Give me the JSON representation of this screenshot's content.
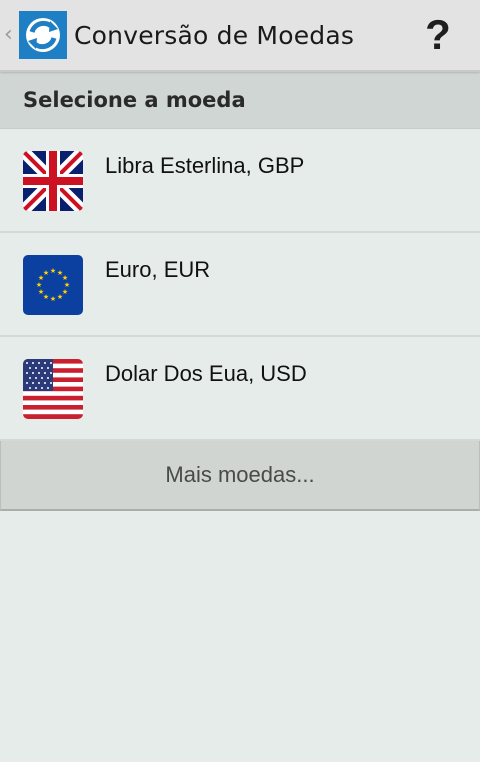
{
  "app": {
    "title": "Conversão de Moedas",
    "back_icon": "back-caret-icon",
    "app_icon": "refresh-exchange-icon",
    "help_label": "?"
  },
  "section": {
    "header": "Selecione a moeda"
  },
  "currencies": [
    {
      "label": "Libra Esterlina, GBP",
      "flag": "uk-flag-icon"
    },
    {
      "label": "Euro, EUR",
      "flag": "eu-flag-icon"
    },
    {
      "label": "Dolar Dos Eua, USD",
      "flag": "us-flag-icon"
    }
  ],
  "more_button": {
    "label": "Mais moedas..."
  },
  "colors": {
    "accent": "#1f7fc4",
    "background": "#e6ece9",
    "header_bg": "#d0d6d3"
  }
}
